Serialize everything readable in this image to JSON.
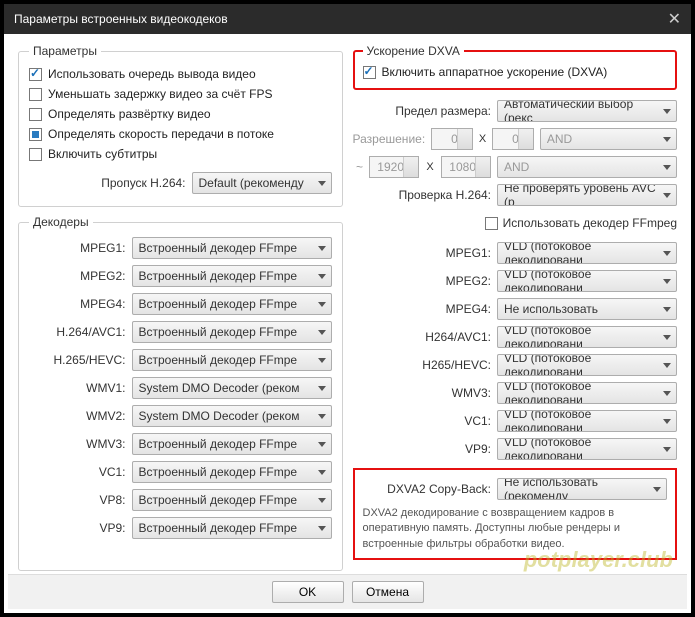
{
  "titlebar": {
    "title": "Параметры встроенных видеокодеков"
  },
  "params": {
    "legend": "Параметры",
    "use_queue": "Использовать очередь вывода видео",
    "reduce_delay": "Уменьшать задержку видео за счёт FPS",
    "detect_scan": "Определять развёртку видео",
    "detect_bitrate": "Определять скорость передачи в потоке",
    "enable_subs": "Включить субтитры",
    "h264_skip_label": "Пропуск H.264:",
    "h264_skip_value": "Default (рекоменду"
  },
  "decoders": {
    "legend": "Декодеры",
    "rows": [
      {
        "label": "MPEG1:",
        "value": "Встроенный декодер FFmpe"
      },
      {
        "label": "MPEG2:",
        "value": "Встроенный декодер FFmpe"
      },
      {
        "label": "MPEG4:",
        "value": "Встроенный декодер FFmpe"
      },
      {
        "label": "H.264/AVC1:",
        "value": "Встроенный декодер FFmpe"
      },
      {
        "label": "H.265/HEVC:",
        "value": "Встроенный декодер FFmpe"
      },
      {
        "label": "WMV1:",
        "value": "System DMO Decoder (реком"
      },
      {
        "label": "WMV2:",
        "value": "System DMO Decoder (реком"
      },
      {
        "label": "WMV3:",
        "value": "Встроенный декодер FFmpe"
      },
      {
        "label": "VC1:",
        "value": "Встроенный декодер FFmpe"
      },
      {
        "label": "VP8:",
        "value": "Встроенный декодер FFmpe"
      },
      {
        "label": "VP9:",
        "value": "Встроенный декодер FFmpe"
      }
    ]
  },
  "dxva": {
    "legend": "Ускорение DXVA",
    "enable": "Включить аппаратное ускорение (DXVA)",
    "size_limit_label": "Предел размера:",
    "size_limit_value": "Автоматический выбор (рекс",
    "resolution_label": "Разрешение:",
    "res_w1": "0",
    "res_h1": "0",
    "res_w2": "1920",
    "res_h2": "1080",
    "tilde": "~",
    "and": "AND",
    "x": "X",
    "h264_check_label": "Проверка H.264:",
    "h264_check_value": "Не проверять уровень AVC (р",
    "use_ffmpeg_decoder": "Использовать декодер FFmpeg",
    "rows": [
      {
        "label": "MPEG1:",
        "value": "VLD (потоковое декодировани"
      },
      {
        "label": "MPEG2:",
        "value": "VLD (потоковое декодировани"
      },
      {
        "label": "MPEG4:",
        "value": "Не использовать"
      },
      {
        "label": "H264/AVC1:",
        "value": "VLD (потоковое декодировани"
      },
      {
        "label": "H265/HEVC:",
        "value": "VLD (потоковое декодировани"
      },
      {
        "label": "WMV3:",
        "value": "VLD (потоковое декодировани"
      },
      {
        "label": "VC1:",
        "value": "VLD (потоковое декодировани"
      },
      {
        "label": "VP9:",
        "value": "VLD (потоковое декодировани"
      }
    ],
    "copyback_label": "DXVA2 Copy-Back:",
    "copyback_value": "Не использовать (рекоменду",
    "copyback_desc": "DXVA2 декодирование с возвращением кадров в оперативную память. Доступны любые рендеры и встроенные фильтры обработки видео."
  },
  "buttons": {
    "ok": "OK",
    "cancel": "Отмена"
  },
  "watermark": "potplayer.club"
}
